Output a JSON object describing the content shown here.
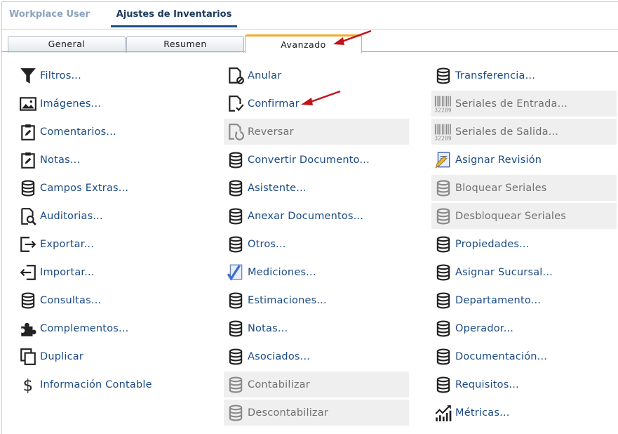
{
  "header": {
    "tabs": [
      {
        "label": "Workplace User"
      },
      {
        "label": "Ajustes de Inventarios"
      }
    ]
  },
  "subtabs": [
    {
      "label": "General"
    },
    {
      "label": "Resumen"
    },
    {
      "label": "Avanzado"
    }
  ],
  "columns": {
    "left": [
      {
        "label": "Filtros...",
        "icon": "filter-icon",
        "disabled": false
      },
      {
        "label": "Imágenes...",
        "icon": "image-icon",
        "disabled": false
      },
      {
        "label": "Comentarios...",
        "icon": "clipboard-edit-icon",
        "disabled": false
      },
      {
        "label": "Notas...",
        "icon": "clipboard-edit-icon",
        "disabled": false
      },
      {
        "label": "Campos Extras...",
        "icon": "database-icon",
        "disabled": false
      },
      {
        "label": "Auditorias...",
        "icon": "audit-search-icon",
        "disabled": false
      },
      {
        "label": "Exportar...",
        "icon": "export-icon",
        "disabled": false
      },
      {
        "label": "Importar...",
        "icon": "import-icon",
        "disabled": false
      },
      {
        "label": "Consultas...",
        "icon": "database-icon",
        "disabled": false
      },
      {
        "label": "Complementos...",
        "icon": "puzzle-icon",
        "disabled": false
      },
      {
        "label": "Duplicar",
        "icon": "duplicate-icon",
        "disabled": false
      },
      {
        "label": "Información Contable",
        "icon": "dollar-icon",
        "disabled": false
      }
    ],
    "middle": [
      {
        "label": "Anular",
        "icon": "document-cancel-icon",
        "disabled": false
      },
      {
        "label": "Confirmar",
        "icon": "document-check-icon",
        "disabled": false
      },
      {
        "label": "Reversar",
        "icon": "document-undo-icon",
        "disabled": true
      },
      {
        "label": "Convertir Documento...",
        "icon": "database-icon",
        "disabled": false
      },
      {
        "label": "Asistente...",
        "icon": "database-icon",
        "disabled": false
      },
      {
        "label": "Anexar Documentos...",
        "icon": "database-icon",
        "disabled": false
      },
      {
        "label": "Otros...",
        "icon": "database-icon",
        "disabled": false
      },
      {
        "label": "Mediciones...",
        "icon": "measure-check-icon",
        "disabled": false
      },
      {
        "label": "Estimaciones...",
        "icon": "database-icon",
        "disabled": false
      },
      {
        "label": "Notas...",
        "icon": "database-icon",
        "disabled": false
      },
      {
        "label": "Asociados...",
        "icon": "database-icon",
        "disabled": false
      },
      {
        "label": "Contabilizar",
        "icon": "database-icon",
        "disabled": true
      },
      {
        "label": "Descontabilizar",
        "icon": "database-icon",
        "disabled": true
      }
    ],
    "right": [
      {
        "label": "Transferencia...",
        "icon": "database-icon",
        "disabled": false
      },
      {
        "label": "Seriales de Entrada...",
        "icon": "barcode-icon",
        "disabled": true
      },
      {
        "label": "Seriales de Salida...",
        "icon": "barcode-icon",
        "disabled": true
      },
      {
        "label": "Asignar Revisión",
        "icon": "revision-icon",
        "disabled": false
      },
      {
        "label": "Bloquear Seriales",
        "icon": "database-icon",
        "disabled": true
      },
      {
        "label": "Desbloquear Seriales",
        "icon": "database-icon",
        "disabled": true
      },
      {
        "label": "Propiedades...",
        "icon": "database-icon",
        "disabled": false
      },
      {
        "label": "Asignar Sucursal...",
        "icon": "database-icon",
        "disabled": false
      },
      {
        "label": "Departamento...",
        "icon": "database-icon",
        "disabled": false
      },
      {
        "label": "Operador...",
        "icon": "database-icon",
        "disabled": false
      },
      {
        "label": "Documentación...",
        "icon": "database-icon",
        "disabled": false
      },
      {
        "label": "Requisitos...",
        "icon": "database-icon",
        "disabled": false
      },
      {
        "label": "Métricas...",
        "icon": "metrics-icon",
        "disabled": false
      }
    ]
  },
  "barcode_text": "32289",
  "colors": {
    "link": "#1a4a84",
    "disabled_text": "#707070",
    "active_tab_accent": "#f0ad2b",
    "annotation_arrow": "#c0141a"
  }
}
